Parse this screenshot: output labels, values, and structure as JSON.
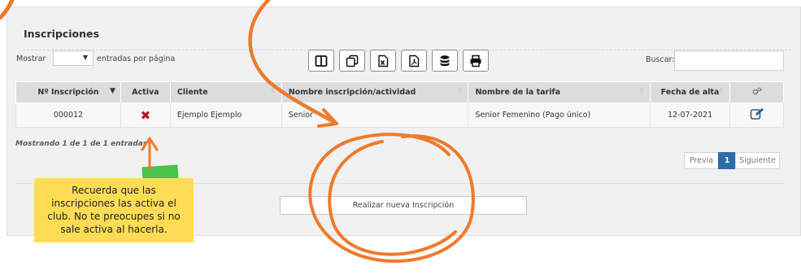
{
  "panel": {
    "title": "Inscripciones"
  },
  "length": {
    "prefix": "Mostrar",
    "suffix": "entradas por página",
    "selected": ""
  },
  "toolbar": {
    "buttons": [
      {
        "name": "columns-icon"
      },
      {
        "name": "copy-icon"
      },
      {
        "name": "excel-icon"
      },
      {
        "name": "pdf-icon"
      },
      {
        "name": "database-icon"
      },
      {
        "name": "print-icon"
      }
    ]
  },
  "search": {
    "label": "Buscar:",
    "value": ""
  },
  "table": {
    "headers": [
      "Nº Inscripción",
      "Activa",
      "Cliente",
      "Nombre inscripción/actividad",
      "Nombre de la tarifa",
      "Fecha de alta"
    ],
    "rows": [
      {
        "numero": "000012",
        "activa": "✖",
        "cliente": "Ejemplo Ejemplo",
        "actividad": "Senior",
        "tarifa": "Senior Femenino (Pago único)",
        "fecha": "12-07-2021"
      }
    ]
  },
  "info": "Mostrando 1 de 1 de 1 entradas",
  "pagination": {
    "prev": "Previa",
    "current": "1",
    "next": "Siguiente"
  },
  "new_button": "Realizar nueva Inscripción",
  "note": {
    "lines": [
      "Recuerda que las",
      "inscripciones las activa el",
      "club. No te preocupes si no",
      "sale activa al hacerla."
    ]
  },
  "colors": {
    "accent_orange": "#f07a2c",
    "note_yellow": "#fedd55",
    "tape_green": "#47c34a",
    "inactive_red": "#b5161b",
    "page_blue": "#2e6ca8"
  }
}
